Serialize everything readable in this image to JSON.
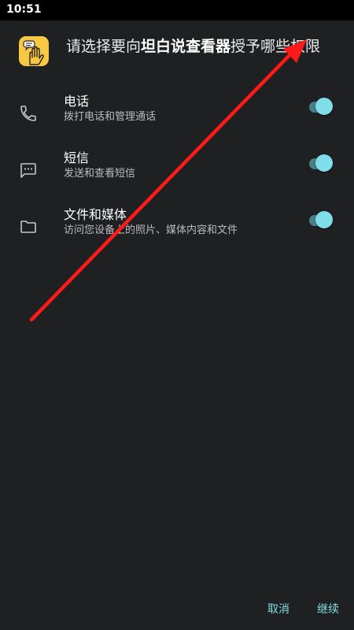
{
  "status_bar": {
    "time": "10:51"
  },
  "dialog": {
    "header_prefix": "请选择要向",
    "app_name": "坦白说查看器",
    "header_suffix": "授予哪些权限",
    "app_icon": "app-logo-hand-icon"
  },
  "permissions": [
    {
      "icon": "phone-icon",
      "title": "电话",
      "description": "拨打电话和管理通话",
      "enabled": true
    },
    {
      "icon": "sms-icon",
      "title": "短信",
      "description": "发送和查看短信",
      "enabled": true
    },
    {
      "icon": "folder-icon",
      "title": "文件和媒体",
      "description": "访问您设备上的照片、媒体内容和文件",
      "enabled": true
    }
  ],
  "buttons": {
    "cancel": "取消",
    "continue": "继续"
  },
  "colors": {
    "background": "#1e2022",
    "accent": "#80deea",
    "annotation_arrow": "#ff0000"
  }
}
